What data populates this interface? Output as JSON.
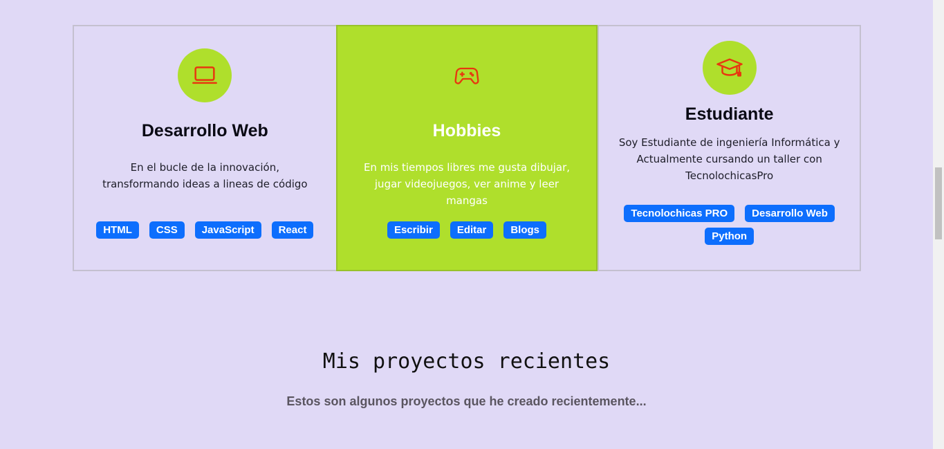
{
  "cards": [
    {
      "title": "Desarrollo Web",
      "description": "En el bucle de la innovación, transformando ideas a lineas de código",
      "icon": "laptop-icon",
      "tags": [
        "HTML",
        "CSS",
        "JavaScript",
        "React"
      ]
    },
    {
      "title": "Hobbies",
      "description": "En mis tiempos libres me gusta dibujar, jugar videojuegos, ver anime y leer mangas",
      "icon": "gamepad-icon",
      "tags": [
        "Escribir",
        "Editar",
        "Blogs"
      ]
    },
    {
      "title": "Estudiante",
      "description": "Soy Estudiante de ingeniería Informática y Actualmente cursando un taller con TecnolochicasPro",
      "icon": "graduation-cap-icon",
      "tags": [
        "Tecnolochicas PRO",
        "Desarrollo Web",
        "Python"
      ]
    }
  ],
  "projects": {
    "title": "Mis proyectos recientes",
    "subtitle": "Estos son algunos proyectos que he creado recientemente..."
  },
  "colors": {
    "background": "#e0d9f6",
    "accent_green": "#afdf2c",
    "icon_red": "#e8370f",
    "tag_blue": "#0d6efd"
  }
}
